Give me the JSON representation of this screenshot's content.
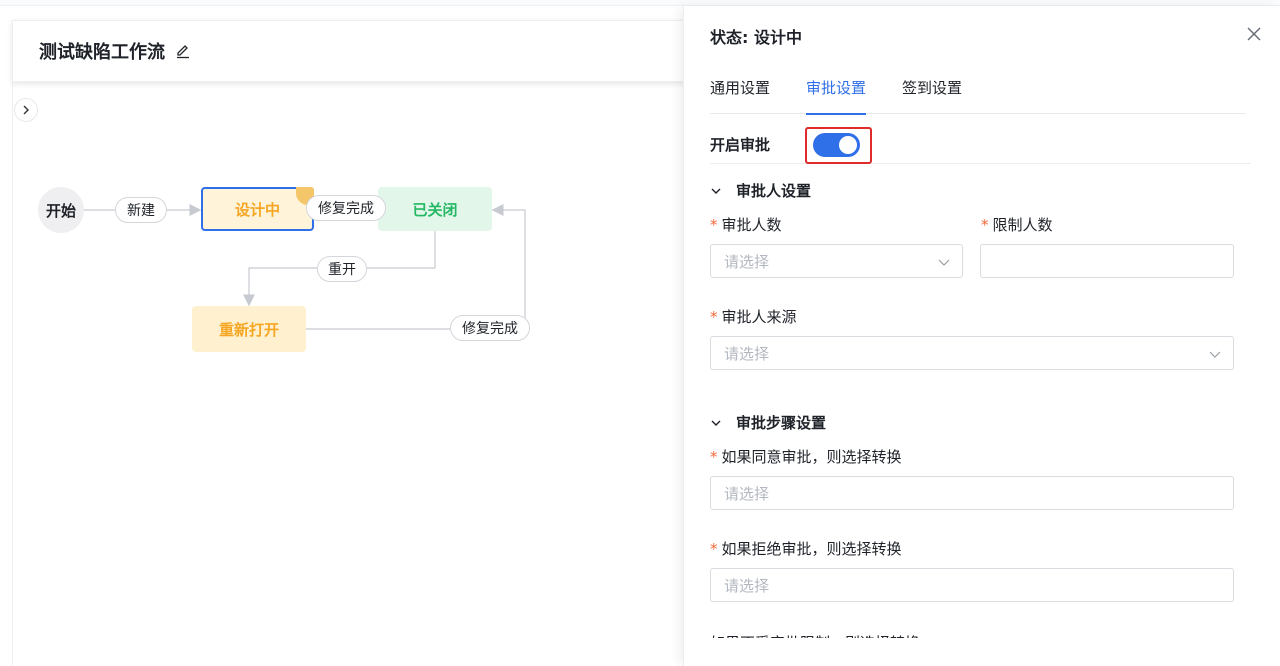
{
  "workflow": {
    "title": "测试缺陷工作流",
    "nodes": {
      "start": "开始",
      "design": "设计中",
      "closed": "已关闭",
      "reopen": "重新打开"
    },
    "edges": {
      "new": "新建",
      "fix_done_1": "修复完成",
      "reopen": "重开",
      "fix_done_2": "修复完成"
    }
  },
  "panel": {
    "title": "状态: 设计中",
    "tabs": [
      {
        "label": "通用设置",
        "active": false
      },
      {
        "label": "审批设置",
        "active": true
      },
      {
        "label": "签到设置",
        "active": false
      }
    ],
    "toggle": {
      "label": "开启审批",
      "on": true
    },
    "approver_section": {
      "title": "审批人设置",
      "approver_count": {
        "label": "审批人数",
        "placeholder": "请选择"
      },
      "limit_count": {
        "label": "限制人数",
        "value": ""
      },
      "approver_source": {
        "label": "审批人来源",
        "placeholder": "请选择"
      }
    },
    "steps_section": {
      "title": "审批步骤设置",
      "if_agree": {
        "label": "如果同意审批，则选择转换",
        "placeholder": "请选择"
      },
      "if_reject": {
        "label": "如果拒绝审批，则选择转换",
        "placeholder": "请选择"
      },
      "if_not_limited": {
        "label": "如果不受审批限制，则选择转换"
      }
    }
  },
  "colors": {
    "accent": "#2f6fe8",
    "highlight_box": "#e02b2b",
    "design_text": "#f5a623",
    "closed_text": "#25b864",
    "required_star": "#f5683a"
  }
}
